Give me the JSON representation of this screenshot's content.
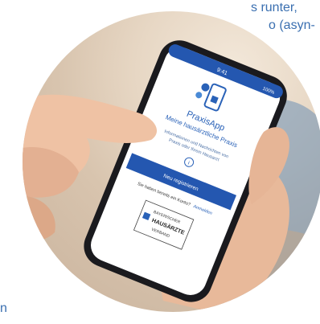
{
  "background_text": {
    "line1": "s runter,",
    "line2": "o (asyn-",
    "line3": "n"
  },
  "phone": {
    "status_bar": {
      "time": "9:41",
      "battery": "100%"
    },
    "app_title": "PraxisApp",
    "app_subtitle": "Meine hausärztliche Praxis",
    "description_line1": "Informationen und Nachrichten von",
    "description_line2": "Praxis oder Ihrem Hausarzt",
    "info_symbol": "i",
    "register_button": "Neu registrieren",
    "login_prompt": "Sie haben bereits ein Konto?",
    "login_link": "Anmelden",
    "logo": {
      "line1": "BAYERISCHER",
      "line2": "HAUSÄRZTE",
      "line3": "VERBAND"
    }
  },
  "colors": {
    "brand_blue": "#2a62b8",
    "button_blue": "#2457b0",
    "screen_bg": "#ffffff",
    "phone_frame": "#1a1a1e"
  },
  "icons": [
    "app-logo-icon",
    "info-icon",
    "hausaerzte-logo-icon"
  ]
}
